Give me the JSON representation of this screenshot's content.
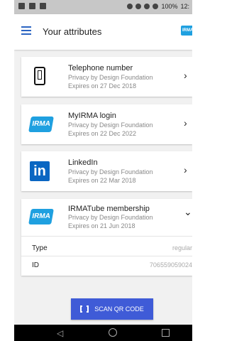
{
  "status_bar": {
    "text": "100%",
    "time": "12:"
  },
  "app_bar": {
    "title": "Your attributes",
    "logo_text": "IRMA"
  },
  "cards": [
    {
      "title": "Telephone number",
      "issuer": "Privacy by Design Foundation",
      "expiry": "Expires on 27 Dec 2018",
      "icon": "phone-icon",
      "chevron": "›"
    },
    {
      "title": "MyIRMA login",
      "issuer": "Privacy by Design Foundation",
      "expiry": "Expires on 22 Dec 2022",
      "icon": "irma-logo",
      "icon_text": "IRMA",
      "chevron": "›"
    },
    {
      "title": "LinkedIn",
      "issuer": "Privacy by Design Foundation",
      "expiry": "Expires on 22 Mar 2018",
      "icon": "linkedin-logo",
      "icon_text": "in",
      "chevron": "›"
    },
    {
      "title": "IRMATube membership",
      "issuer": "Privacy by Design Foundation",
      "expiry": "Expires on 21 Jun 2018",
      "icon": "irma-logo",
      "icon_text": "IRMA",
      "chevron": "⌄",
      "attributes": [
        {
          "label": "Type",
          "value": "regular"
        },
        {
          "label": "ID",
          "value": "706559059024"
        }
      ]
    }
  ],
  "scan_button": {
    "label": "SCAN QR CODE"
  },
  "nav": {
    "back": "◁"
  }
}
